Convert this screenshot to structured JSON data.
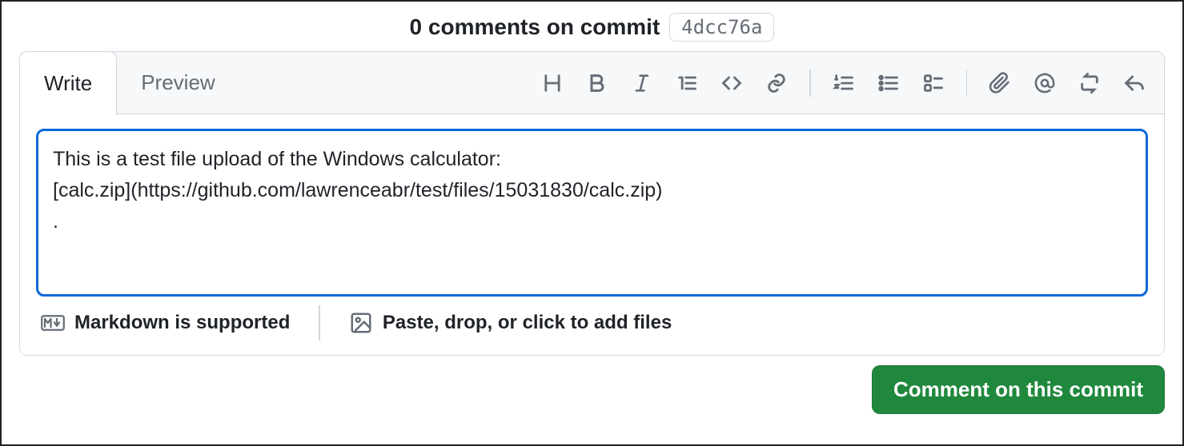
{
  "header": {
    "title": "0 comments on commit",
    "sha": "4dcc76a"
  },
  "tabs": {
    "write": "Write",
    "preview": "Preview"
  },
  "editor": {
    "value": "This is a test file upload of the Windows calculator:\n[calc.zip](https://github.com/lawrenceabr/test/files/15031830/calc.zip)\n."
  },
  "footer": {
    "markdown": "Markdown is supported",
    "attach": "Paste, drop, or click to add files"
  },
  "actions": {
    "submit": "Comment on this commit"
  }
}
